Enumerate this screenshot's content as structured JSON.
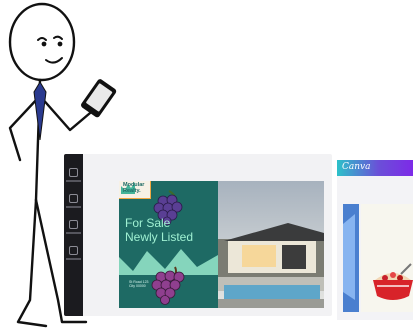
{
  "canvas": {
    "logo_text": "Modular\nRealty.",
    "headline_line1": "For Sale",
    "headline_line2": "Newly Listed",
    "address_text": "St Road 123\nCity 00000"
  },
  "canva_panel": {
    "logo": "Canva"
  },
  "colors": {
    "teal_panel": "#1e6a64",
    "headline": "#9ff0d2",
    "logo_highlight": "#f0a842",
    "canva_gradient_start": "#2cc1c9",
    "canva_gradient_end": "#7d2ae8",
    "tie": "#2a3a8f"
  },
  "icons": [
    "grapes-icon",
    "grapes-icon",
    "salad-bowl-icon",
    "smartphone-icon"
  ]
}
